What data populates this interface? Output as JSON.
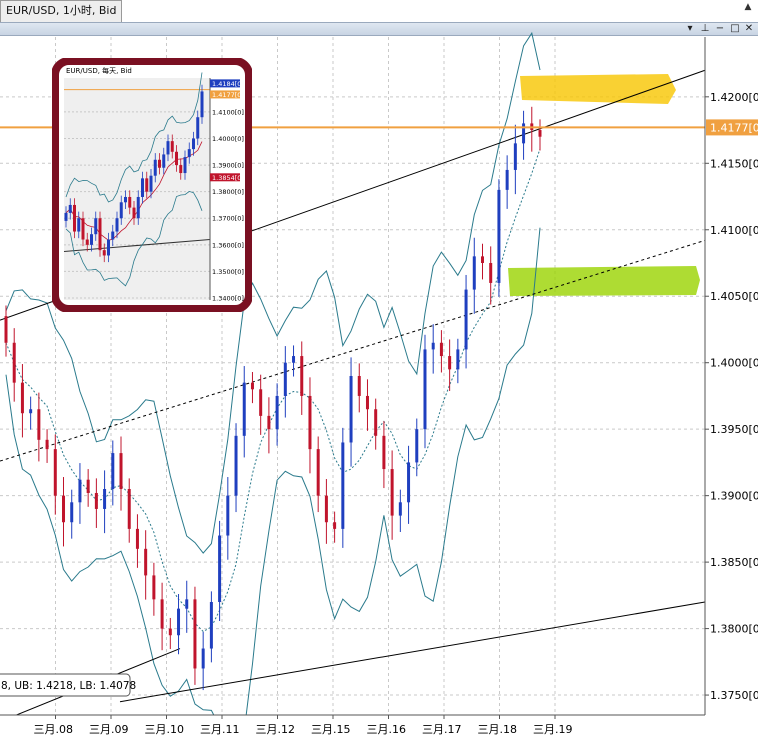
{
  "window": {
    "tab_title": "EUR/USD, 1小时, Bid",
    "controls": [
      "▾",
      "⊥",
      "−",
      "□",
      "✕"
    ],
    "scroll_up": "▲"
  },
  "chart_data": {
    "type": "candlestick",
    "symbol": "EUR/USD",
    "timeframe": "1小时",
    "price": "Bid",
    "ylim": [
      1.3735,
      1.4245
    ],
    "y_ticks": [
      "1.4200[0]",
      "1.4150[0]",
      "1.4100[0]",
      "1.4050[0]",
      "1.4000[0]",
      "1.3950[0]",
      "1.3900[0]",
      "1.3850[0]",
      "1.3800[0]",
      "1.3750[0]"
    ],
    "x_ticks": [
      "三月.08",
      "三月.09",
      "三月.10",
      "三月.11",
      "三月.12",
      "三月.15",
      "三月.16",
      "三月.17",
      "三月.18",
      "三月.19"
    ],
    "current_price_label": "1.4177[0]",
    "current_price": 1.4177,
    "channel_readout": "8, UB: 1.4218, LB: 1.4078",
    "close_path": [
      1.4015,
      1.3985,
      1.3962,
      1.3965,
      1.3942,
      1.3935,
      1.39,
      1.388,
      1.3895,
      1.3912,
      1.3902,
      1.389,
      1.3905,
      1.3932,
      1.3905,
      1.3875,
      1.386,
      1.384,
      1.3822,
      1.38,
      1.3795,
      1.3815,
      1.3822,
      1.377,
      1.3785,
      1.382,
      1.387,
      1.39,
      1.3945,
      1.3985,
      1.398,
      1.396,
      1.395,
      1.3975,
      1.4,
      1.4005,
      1.3975,
      1.3935,
      1.39,
      1.388,
      1.3875,
      1.394,
      1.399,
      1.3975,
      1.3965,
      1.3945,
      1.392,
      1.3885,
      1.3895,
      1.3925,
      1.395,
      1.401,
      1.4015,
      1.4005,
      1.3995,
      1.401,
      1.4055,
      1.408,
      1.4075,
      1.406,
      1.413,
      1.4145,
      1.4165,
      1.418,
      1.4175,
      1.417
    ],
    "annotations": [
      "yellow-highlight-upper",
      "green-highlight-lower"
    ],
    "inset": {
      "title": "EUR/USD, 每天, Bid",
      "y_ticks": [
        "1.4100[0]",
        "1.4000[0]",
        "1.3900[0]",
        "1.3800[0]",
        "1.3700[0]",
        "1.3600[0]",
        "1.3500[0]",
        "1.3400[0]"
      ],
      "price_labels": [
        "1.4184[0]",
        "1.4177[0]",
        "1.3854[0]"
      ],
      "close_path": [
        1.372,
        1.375,
        1.365,
        1.37,
        1.362,
        1.36,
        1.364,
        1.37,
        1.358,
        1.356,
        1.362,
        1.365,
        1.37,
        1.376,
        1.378,
        1.374,
        1.37,
        1.378,
        1.385,
        1.38,
        1.386,
        1.392,
        1.389,
        1.394,
        1.399,
        1.395,
        1.39,
        1.387,
        1.393,
        1.396,
        1.4,
        1.408,
        1.4177
      ]
    }
  }
}
